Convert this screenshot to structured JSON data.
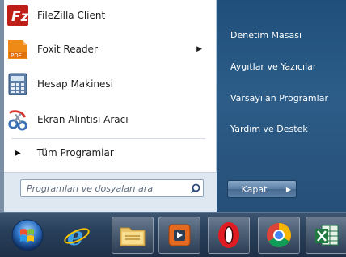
{
  "start_menu": {
    "programs": [
      {
        "label": "FileZilla Client",
        "icon": "filezilla-icon",
        "submenu": false
      },
      {
        "label": "Foxit Reader",
        "icon": "foxit-reader-icon",
        "submenu": true
      },
      {
        "label": "Hesap Makinesi",
        "icon": "calculator-icon",
        "submenu": false
      },
      {
        "label": "Ekran Alıntısı Aracı",
        "icon": "snipping-tool-icon",
        "submenu": false
      }
    ],
    "all_programs": "Tüm Programlar",
    "search": {
      "placeholder": "Programları ve dosyaları ara"
    },
    "right_links": [
      "Denetim Masası",
      "Aygıtlar ve Yazıcılar",
      "Varsayılan Programlar",
      "Yardım ve Destek"
    ],
    "shutdown_label": "Kapat"
  },
  "taskbar": {
    "items": [
      "start-orb-icon",
      "internet-explorer-icon",
      "file-explorer-icon",
      "media-player-icon",
      "opera-icon",
      "chrome-icon",
      "excel-icon"
    ]
  }
}
